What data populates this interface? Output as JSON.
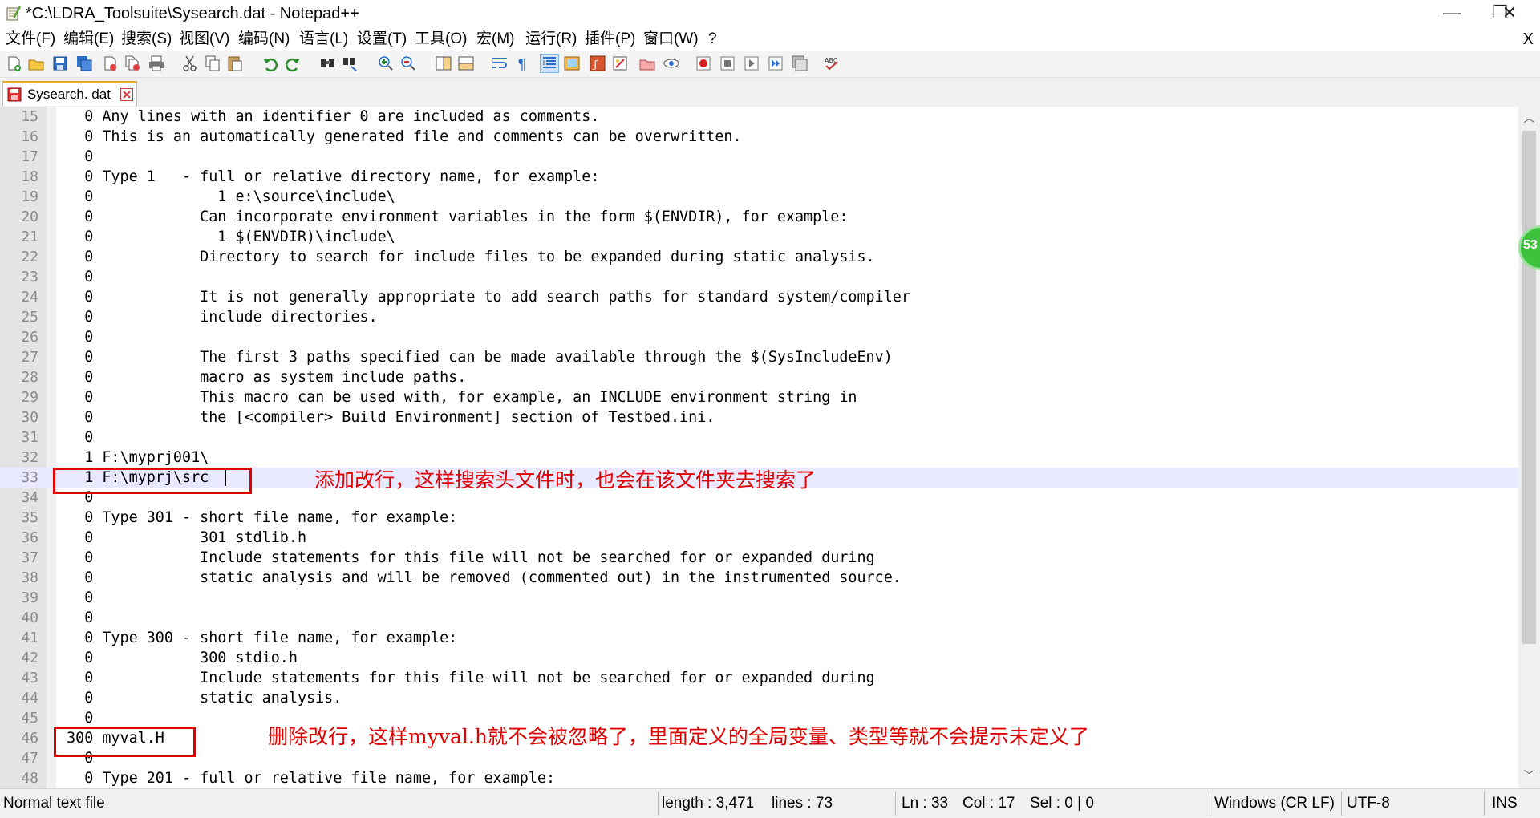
{
  "window": {
    "title": "*C:\\LDRA_Toolsuite\\Sysearch.dat - Notepad++",
    "minimize_glyph": "—",
    "restore_glyph": "❐",
    "close_glyph": "✕"
  },
  "menu": {
    "items": [
      "文件(F)",
      "编辑(E)",
      "搜索(S)",
      "视图(V)",
      "编码(N)",
      "语言(L)",
      "设置(T)",
      "工具(O)",
      "宏(M)",
      "运行(R)",
      "插件(P)",
      "窗口(W)",
      "?"
    ],
    "close_glyph": "X"
  },
  "toolbar": {
    "buttons": [
      "new-file",
      "open-file",
      "save",
      "save-all",
      "close",
      "close-all",
      "print",
      "cut",
      "copy",
      "paste",
      "undo",
      "redo",
      "find",
      "replace",
      "zoom-in",
      "zoom-out",
      "sync-vertical",
      "sync-horizontal",
      "word-wrap",
      "show-all-chars",
      "indent-guide",
      "doc-map",
      "function-list",
      "folder-workspace",
      "monitoring",
      "record-macro",
      "stop-record",
      "play-macro",
      "run-macro-multiple",
      "save-macro",
      "spell-check"
    ]
  },
  "tab": {
    "label": "Sysearch. dat"
  },
  "editor": {
    "current_line": "33",
    "lines": [
      {
        "n": "15",
        "text": "   0 Any lines with an identifier 0 are included as comments."
      },
      {
        "n": "16",
        "text": "   0 This is an automatically generated file and comments can be overwritten."
      },
      {
        "n": "17",
        "text": "   0"
      },
      {
        "n": "18",
        "text": "   0 Type 1   - full or relative directory name, for example:"
      },
      {
        "n": "19",
        "text": "   0              1 e:\\source\\include\\"
      },
      {
        "n": "20",
        "text": "   0            Can incorporate environment variables in the form $(ENVDIR), for example:"
      },
      {
        "n": "21",
        "text": "   0              1 $(ENVDIR)\\include\\"
      },
      {
        "n": "22",
        "text": "   0            Directory to search for include files to be expanded during static analysis."
      },
      {
        "n": "23",
        "text": "   0"
      },
      {
        "n": "24",
        "text": "   0            It is not generally appropriate to add search paths for standard system/compiler"
      },
      {
        "n": "25",
        "text": "   0            include directories."
      },
      {
        "n": "26",
        "text": "   0"
      },
      {
        "n": "27",
        "text": "   0            The first 3 paths specified can be made available through the $(SysIncludeEnv)"
      },
      {
        "n": "28",
        "text": "   0            macro as system include paths."
      },
      {
        "n": "29",
        "text": "   0            This macro can be used with, for example, an INCLUDE environment string in"
      },
      {
        "n": "30",
        "text": "   0            the [<compiler> Build Environment] section of Testbed.ini."
      },
      {
        "n": "31",
        "text": "   0"
      },
      {
        "n": "32",
        "text": "   1 F:\\myprj001\\"
      },
      {
        "n": "33",
        "text": "   1 F:\\myprj\\src"
      },
      {
        "n": "34",
        "text": "   0"
      },
      {
        "n": "35",
        "text": "   0 Type 301 - short file name, for example:"
      },
      {
        "n": "36",
        "text": "   0            301 stdlib.h"
      },
      {
        "n": "37",
        "text": "   0            Include statements for this file will not be searched for or expanded during"
      },
      {
        "n": "38",
        "text": "   0            static analysis and will be removed (commented out) in the instrumented source."
      },
      {
        "n": "39",
        "text": "   0"
      },
      {
        "n": "40",
        "text": "   0"
      },
      {
        "n": "41",
        "text": "   0 Type 300 - short file name, for example:"
      },
      {
        "n": "42",
        "text": "   0            300 stdio.h"
      },
      {
        "n": "43",
        "text": "   0            Include statements for this file will not be searched for or expanded during"
      },
      {
        "n": "44",
        "text": "   0            static analysis."
      },
      {
        "n": "45",
        "text": "   0"
      },
      {
        "n": "46",
        "text": " 300 myval.H"
      },
      {
        "n": "47",
        "text": "   0"
      },
      {
        "n": "48",
        "text": "   0 Type 201 - full or relative file name, for example:"
      }
    ]
  },
  "annotations": {
    "note_add": "添加改行，这样搜索头文件时，也会在该文件夹去搜索了",
    "note_delete": "删除改行，这样myval.h就不会被忽略了，里面定义的全局变量、类型等就不会提示未定义了"
  },
  "side_badge": {
    "value": "53"
  },
  "scrollbar": {
    "up_glyph": "︿",
    "down_glyph": "﹀"
  },
  "status": {
    "file_type": "Normal text file",
    "length": "length : 3,471",
    "lines": "lines : 73",
    "ln": "Ln : 33",
    "col": "Col : 17",
    "sel": "Sel : 0 | 0",
    "eol": "Windows (CR LF)",
    "encoding": "UTF-8",
    "mode": "INS"
  }
}
